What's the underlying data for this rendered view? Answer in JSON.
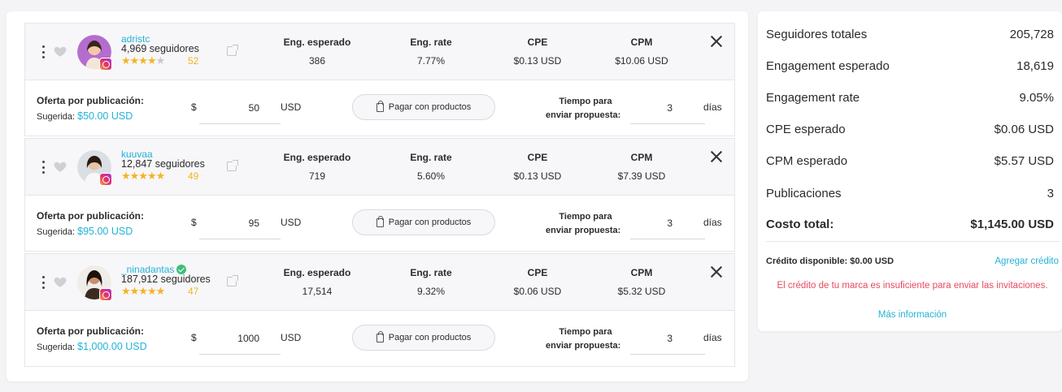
{
  "influencers": [
    {
      "username": "adristc",
      "verified": false,
      "followers": "4,969 seguidores",
      "stars_filled": 4,
      "rating": "52",
      "eng_esperado": "386",
      "eng_rate": "7.77%",
      "cpe": "$0.13 USD",
      "cpm": "$10.06 USD",
      "offer_value": "50",
      "suggested": "$50.00 USD",
      "days_value": "3",
      "avatar_color": "#b46dcf"
    },
    {
      "username": "kuuvaa",
      "verified": false,
      "followers": "12,847 seguidores",
      "stars_filled": 5,
      "rating": "49",
      "eng_esperado": "719",
      "eng_rate": "5.60%",
      "cpe": "$0.13 USD",
      "cpm": "$7.39 USD",
      "offer_value": "95",
      "suggested": "$95.00 USD",
      "days_value": "3",
      "avatar_color": "#cfd5d8"
    },
    {
      "username": "_ninadantas",
      "verified": true,
      "followers": "187,912 seguidores",
      "stars_filled": 5,
      "rating": "47",
      "eng_esperado": "17,514",
      "eng_rate": "9.32%",
      "cpe": "$0.06 USD",
      "cpm": "$5.32 USD",
      "offer_value": "1000",
      "suggested": "$1,000.00 USD",
      "days_value": "3",
      "avatar_color": "#4a2f24"
    }
  ],
  "labels": {
    "eng_esperado": "Eng. esperado",
    "eng_rate": "Eng. rate",
    "cpe": "CPE",
    "cpm": "CPM",
    "offer": "Oferta por publicación:",
    "suggested_prefix": "Sugerida: ",
    "dollar": "$",
    "currency": "USD",
    "pay_with_products": "Pagar con productos",
    "time_line1": "Tiempo para",
    "time_line2": "enviar propuesta:",
    "days": "días"
  },
  "summary": {
    "rows": [
      {
        "label": "Seguidores totales",
        "value": "205,728"
      },
      {
        "label": "Engagement esperado",
        "value": "18,619"
      },
      {
        "label": "Engagement rate",
        "value": "9.05%"
      },
      {
        "label": "CPE esperado",
        "value": "$0.06 USD"
      },
      {
        "label": "CPM esperado",
        "value": "$5.57 USD"
      },
      {
        "label": "Publicaciones",
        "value": "3"
      }
    ],
    "total_label": "Costo total:",
    "total_value": "$1,145.00 USD",
    "credit_label": "Crédito disponible: $0.00 USD",
    "add_credit": "Agregar crédito",
    "warning": "El crédito de tu marca es insuficiente para enviar las invitaciones.",
    "more_info": "Más información"
  },
  "colors": {
    "accent": "#23b2d8",
    "star": "#f5b324",
    "warning": "#e84a5f"
  }
}
